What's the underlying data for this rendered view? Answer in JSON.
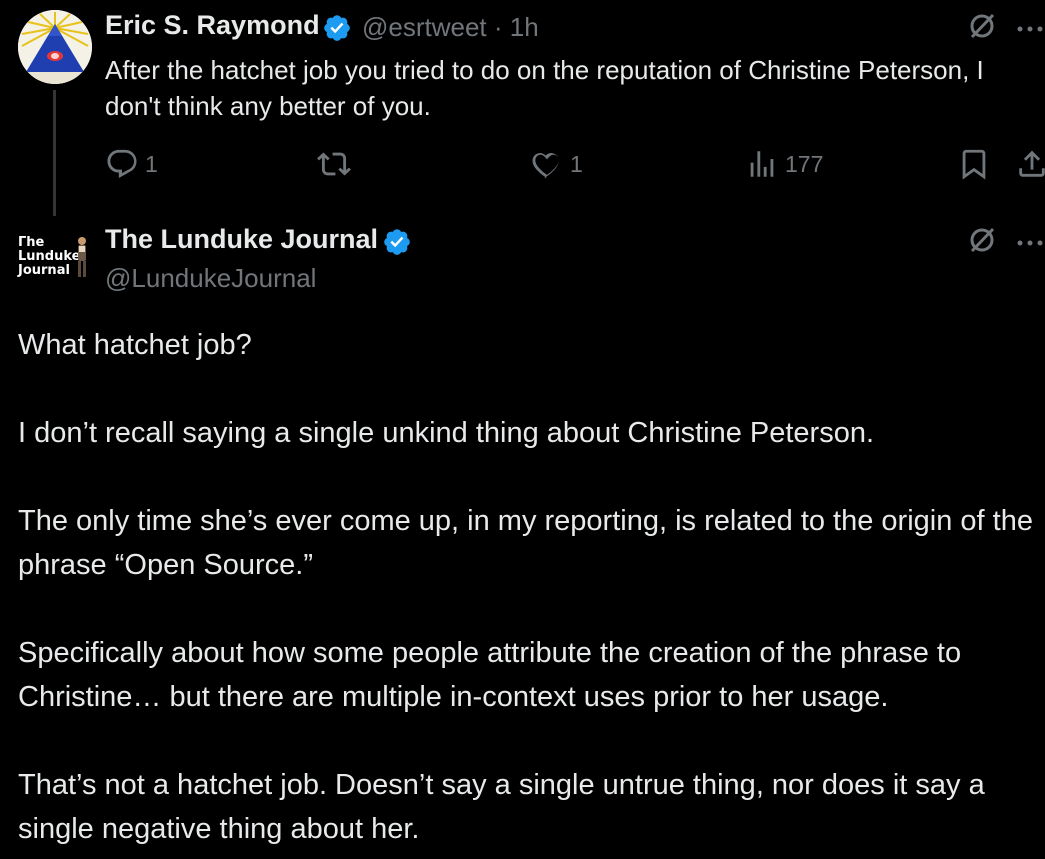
{
  "parent_tweet": {
    "author_name": "Eric S. Raymond",
    "handle_time": "@esrtweet · 1h",
    "text": "After the hatchet job you tried to do on the reputation of Christine Peterson, I don't think any better of you.",
    "reply_count": "1",
    "like_count": "1",
    "view_count": "177",
    "icons": [
      "reply-icon",
      "retweet-icon",
      "like-icon",
      "views-icon",
      "bookmark-icon",
      "share-icon",
      "grok-icon",
      "more-icon"
    ]
  },
  "reply_tweet": {
    "author_name": "The Lunduke Journal",
    "handle": "@LundukeJournal",
    "avatar_logo_text": "The Lunduke Journal",
    "paragraphs": [
      "What hatchet job?",
      "I don’t recall saying a single unkind thing about Christine Peterson.",
      "The only time she’s ever come up, in my reporting, is related to the origin of the phrase “Open Source.”",
      "Specifically about how some people attribute the creation of the phrase to Christine… but there are multiple in-context uses prior to her usage.",
      "That’s not a hatchet job.  Doesn’t say a single untrue thing, nor does it say a single negative thing about her."
    ]
  },
  "colors": {
    "background": "#000000",
    "text_primary": "#e7e9ea",
    "text_secondary": "#71767b",
    "verified_blue": "#1d9bf0",
    "thread_line": "#333639"
  }
}
